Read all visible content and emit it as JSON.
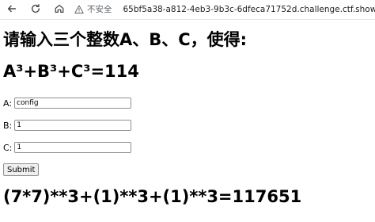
{
  "browser": {
    "security_label": "不安全",
    "url": "65bf5a38-a812-4eb3-9b3c-6dfeca71752d.challenge.ctf.show"
  },
  "page": {
    "title": "请输入三个整数A、B、C，使得:",
    "equation": "A³+B³+C³=114",
    "fields": [
      {
        "label": "A:",
        "value": "config"
      },
      {
        "label": "B:",
        "value": "1"
      },
      {
        "label": "C:",
        "value": "1"
      }
    ],
    "submit_label": "Submit",
    "result": "(7*7)**3+(1)**3+(1)**3=117651"
  }
}
